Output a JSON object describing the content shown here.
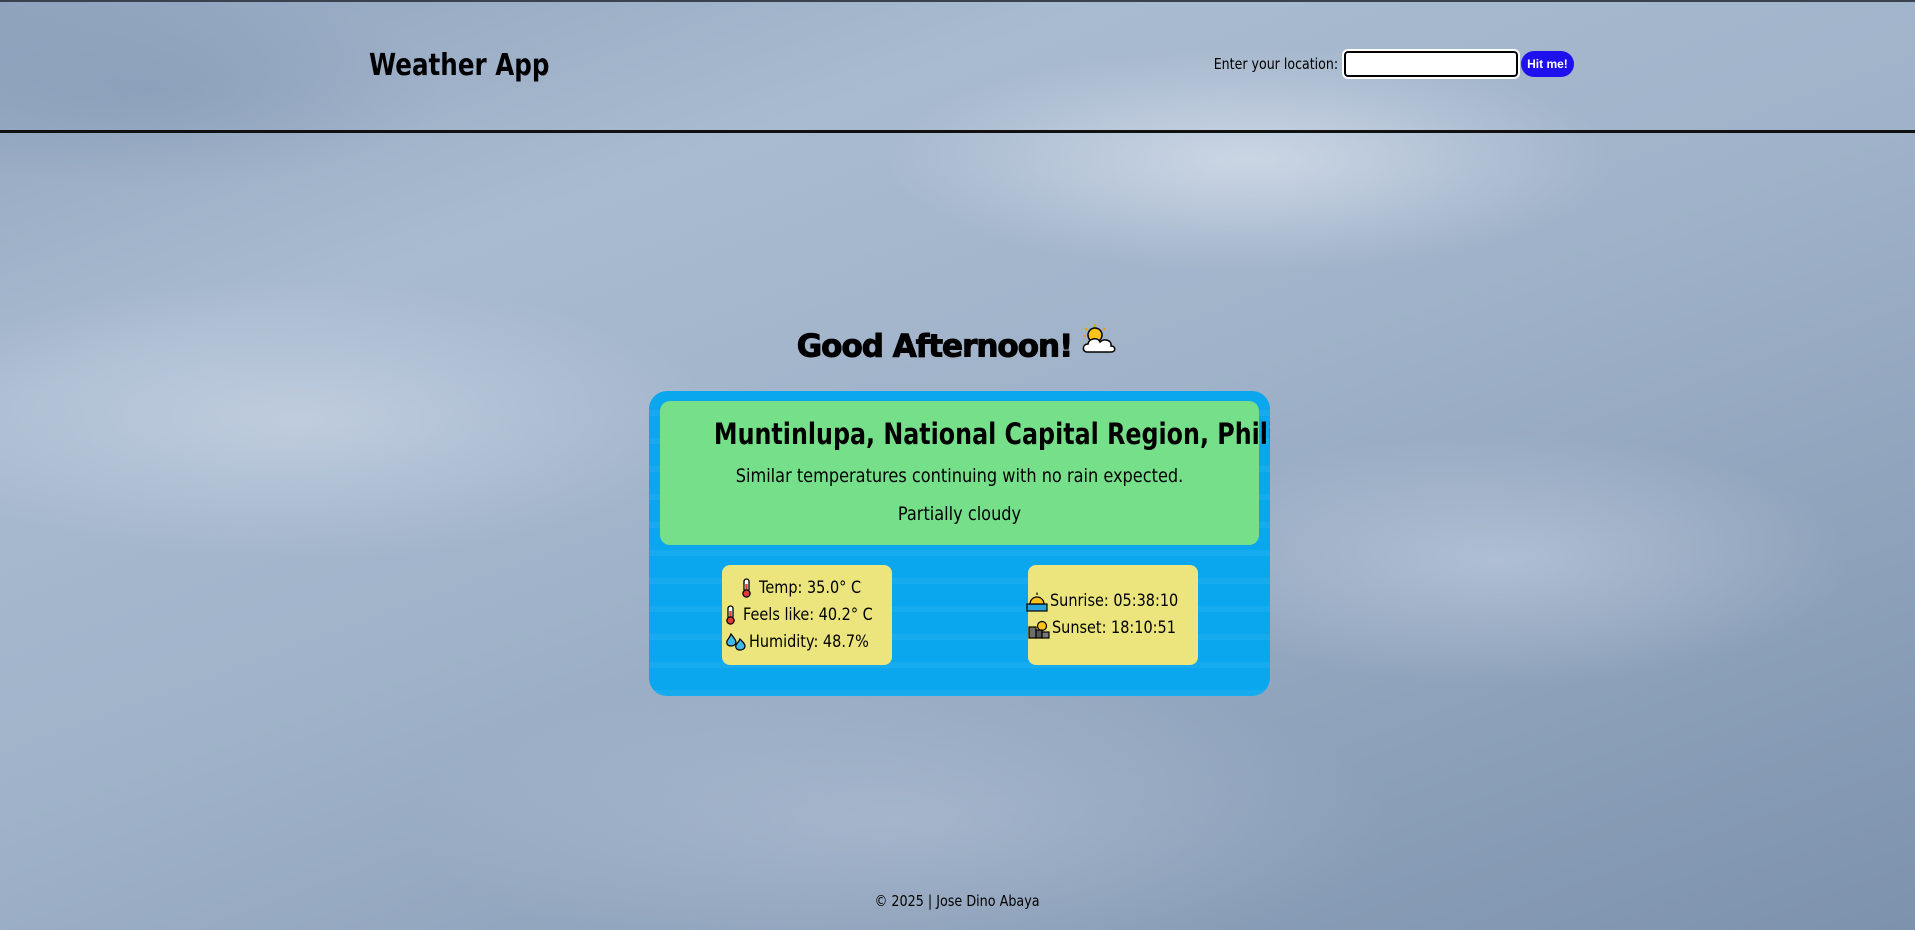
{
  "header": {
    "title": "Weather App",
    "search": {
      "label": "Enter your location:",
      "value": "",
      "button_label": "Hit me!"
    }
  },
  "greeting": {
    "text": "Good Afternoon!",
    "icon": "sun-behind-cloud-icon"
  },
  "weather": {
    "location": "Muntinlupa, National Capital Region, Philippines",
    "forecast": "Similar temperatures continuing with no rain expected.",
    "condition": "Partially cloudy",
    "stats": {
      "temp": "Temp: 35.0° C",
      "feels_like": "Feels like: 40.2° C",
      "humidity": "Humidity: 48.7%"
    },
    "sun": {
      "sunrise": "Sunrise: 05:38:10",
      "sunset": "Sunset: 18:10:51"
    },
    "icons": {
      "temp": "thermometer-icon",
      "feels_like": "thermometer-icon",
      "humidity": "droplets-icon",
      "sunrise": "sunrise-icon",
      "sunset": "sunset-city-icon"
    }
  },
  "footer": {
    "text": "© 2025 | Jose Dino Abaya"
  },
  "colors": {
    "card_bg": "#0aa6ee",
    "location_box": "#75df8a",
    "stat_box": "#ece57d",
    "button_bg": "#1f10f0"
  }
}
